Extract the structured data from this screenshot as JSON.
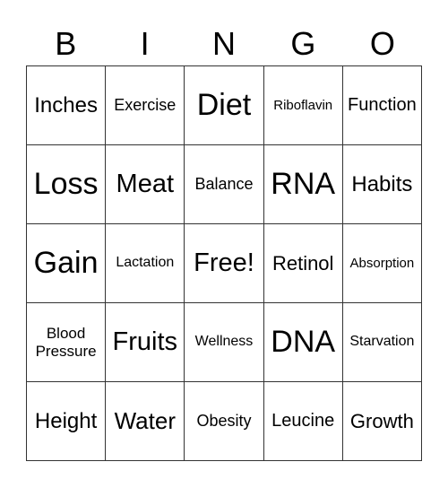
{
  "header": [
    "B",
    "I",
    "N",
    "G",
    "O"
  ],
  "cells": [
    [
      "Inches",
      "Exercise",
      "Diet",
      "Riboflavin",
      "Function"
    ],
    [
      "Loss",
      "Meat",
      "Balance",
      "RNA",
      "Habits"
    ],
    [
      "Gain",
      "Lactation",
      "Free!",
      "Retinol",
      "Absorption"
    ],
    [
      "Blood\nPressure",
      "Fruits",
      "Wellness",
      "DNA",
      "Starvation"
    ],
    [
      "Height",
      "Water",
      "Obesity",
      "Leucine",
      "Growth"
    ]
  ]
}
